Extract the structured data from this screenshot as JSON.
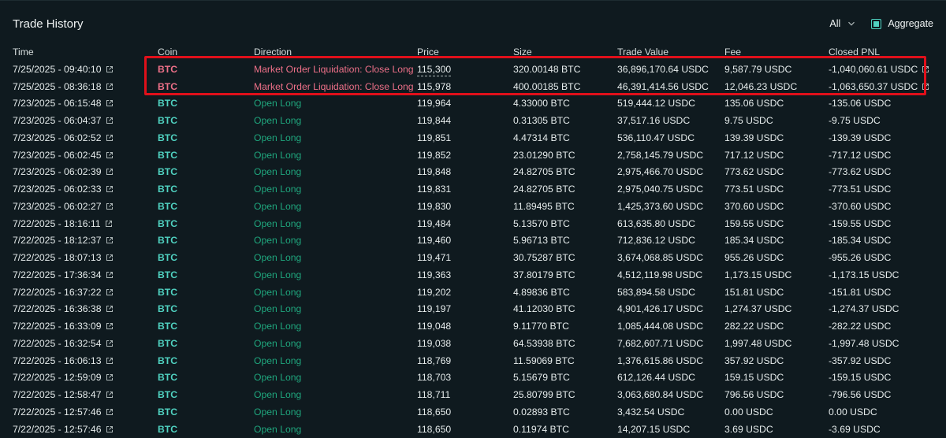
{
  "panel": {
    "title": "Trade History",
    "filter_value": "All",
    "aggregate_label": "Aggregate",
    "accent_color": "#50d2c1",
    "liquidation_color": "#ed7088",
    "open_long_color": "#1fa67d"
  },
  "table": {
    "headers": [
      "Time",
      "Coin",
      "Direction",
      "Price",
      "Size",
      "Trade Value",
      "Fee",
      "Closed PNL"
    ],
    "rows": [
      {
        "time": "7/25/2025 - 09:40:10",
        "coin": "BTC",
        "direction": "Market Order Liquidation: Close Long",
        "price": "115,300",
        "size": "320.00148 BTC",
        "value": "36,896,170.64 USDC",
        "fee": "9,587.79 USDC",
        "pnl": "-1,040,060.61 USDC",
        "liq": true
      },
      {
        "time": "7/25/2025 - 08:36:18",
        "coin": "BTC",
        "direction": "Market Order Liquidation: Close Long",
        "price": "115,978",
        "size": "400.00185 BTC",
        "value": "46,391,414.56 USDC",
        "fee": "12,046.23 USDC",
        "pnl": "-1,063,650.37 USDC",
        "liq": true
      },
      {
        "time": "7/23/2025 - 06:15:48",
        "coin": "BTC",
        "direction": "Open Long",
        "price": "119,964",
        "size": "4.33000 BTC",
        "value": "519,444.12 USDC",
        "fee": "135.06 USDC",
        "pnl": "-135.06 USDC"
      },
      {
        "time": "7/23/2025 - 06:04:37",
        "coin": "BTC",
        "direction": "Open Long",
        "price": "119,844",
        "size": "0.31305 BTC",
        "value": "37,517.16 USDC",
        "fee": "9.75 USDC",
        "pnl": "-9.75 USDC"
      },
      {
        "time": "7/23/2025 - 06:02:52",
        "coin": "BTC",
        "direction": "Open Long",
        "price": "119,851",
        "size": "4.47314 BTC",
        "value": "536,110.47 USDC",
        "fee": "139.39 USDC",
        "pnl": "-139.39 USDC"
      },
      {
        "time": "7/23/2025 - 06:02:45",
        "coin": "BTC",
        "direction": "Open Long",
        "price": "119,852",
        "size": "23.01290 BTC",
        "value": "2,758,145.79 USDC",
        "fee": "717.12 USDC",
        "pnl": "-717.12 USDC"
      },
      {
        "time": "7/23/2025 - 06:02:39",
        "coin": "BTC",
        "direction": "Open Long",
        "price": "119,848",
        "size": "24.82705 BTC",
        "value": "2,975,466.70 USDC",
        "fee": "773.62 USDC",
        "pnl": "-773.62 USDC"
      },
      {
        "time": "7/23/2025 - 06:02:33",
        "coin": "BTC",
        "direction": "Open Long",
        "price": "119,831",
        "size": "24.82705 BTC",
        "value": "2,975,040.75 USDC",
        "fee": "773.51 USDC",
        "pnl": "-773.51 USDC"
      },
      {
        "time": "7/23/2025 - 06:02:27",
        "coin": "BTC",
        "direction": "Open Long",
        "price": "119,830",
        "size": "11.89495 BTC",
        "value": "1,425,373.60 USDC",
        "fee": "370.60 USDC",
        "pnl": "-370.60 USDC"
      },
      {
        "time": "7/22/2025 - 18:16:11",
        "coin": "BTC",
        "direction": "Open Long",
        "price": "119,484",
        "size": "5.13570 BTC",
        "value": "613,635.80 USDC",
        "fee": "159.55 USDC",
        "pnl": "-159.55 USDC"
      },
      {
        "time": "7/22/2025 - 18:12:37",
        "coin": "BTC",
        "direction": "Open Long",
        "price": "119,460",
        "size": "5.96713 BTC",
        "value": "712,836.12 USDC",
        "fee": "185.34 USDC",
        "pnl": "-185.34 USDC"
      },
      {
        "time": "7/22/2025 - 18:07:13",
        "coin": "BTC",
        "direction": "Open Long",
        "price": "119,471",
        "size": "30.75287 BTC",
        "value": "3,674,068.85 USDC",
        "fee": "955.26 USDC",
        "pnl": "-955.26 USDC"
      },
      {
        "time": "7/22/2025 - 17:36:34",
        "coin": "BTC",
        "direction": "Open Long",
        "price": "119,363",
        "size": "37.80179 BTC",
        "value": "4,512,119.98 USDC",
        "fee": "1,173.15 USDC",
        "pnl": "-1,173.15 USDC"
      },
      {
        "time": "7/22/2025 - 16:37:22",
        "coin": "BTC",
        "direction": "Open Long",
        "price": "119,202",
        "size": "4.89836 BTC",
        "value": "583,894.58 USDC",
        "fee": "151.81 USDC",
        "pnl": "-151.81 USDC"
      },
      {
        "time": "7/22/2025 - 16:36:38",
        "coin": "BTC",
        "direction": "Open Long",
        "price": "119,197",
        "size": "41.12030 BTC",
        "value": "4,901,426.17 USDC",
        "fee": "1,274.37 USDC",
        "pnl": "-1,274.37 USDC"
      },
      {
        "time": "7/22/2025 - 16:33:09",
        "coin": "BTC",
        "direction": "Open Long",
        "price": "119,048",
        "size": "9.11770 BTC",
        "value": "1,085,444.08 USDC",
        "fee": "282.22 USDC",
        "pnl": "-282.22 USDC"
      },
      {
        "time": "7/22/2025 - 16:32:54",
        "coin": "BTC",
        "direction": "Open Long",
        "price": "119,038",
        "size": "64.53938 BTC",
        "value": "7,682,607.71 USDC",
        "fee": "1,997.48 USDC",
        "pnl": "-1,997.48 USDC"
      },
      {
        "time": "7/22/2025 - 16:06:13",
        "coin": "BTC",
        "direction": "Open Long",
        "price": "118,769",
        "size": "11.59069 BTC",
        "value": "1,376,615.86 USDC",
        "fee": "357.92 USDC",
        "pnl": "-357.92 USDC"
      },
      {
        "time": "7/22/2025 - 12:59:09",
        "coin": "BTC",
        "direction": "Open Long",
        "price": "118,703",
        "size": "5.15679 BTC",
        "value": "612,126.44 USDC",
        "fee": "159.15 USDC",
        "pnl": "-159.15 USDC"
      },
      {
        "time": "7/22/2025 - 12:58:47",
        "coin": "BTC",
        "direction": "Open Long",
        "price": "118,711",
        "size": "25.80799 BTC",
        "value": "3,063,680.84 USDC",
        "fee": "796.56 USDC",
        "pnl": "-796.56 USDC"
      },
      {
        "time": "7/22/2025 - 12:57:46",
        "coin": "BTC",
        "direction": "Open Long",
        "price": "118,650",
        "size": "0.02893 BTC",
        "value": "3,432.54 USDC",
        "fee": "0.00 USDC",
        "pnl": "0.00 USDC"
      },
      {
        "time": "7/22/2025 - 12:57:46",
        "coin": "BTC",
        "direction": "Open Long",
        "price": "118,650",
        "size": "0.11974 BTC",
        "value": "14,207.15 USDC",
        "fee": "3.69 USDC",
        "pnl": "-3.69 USDC"
      }
    ]
  }
}
